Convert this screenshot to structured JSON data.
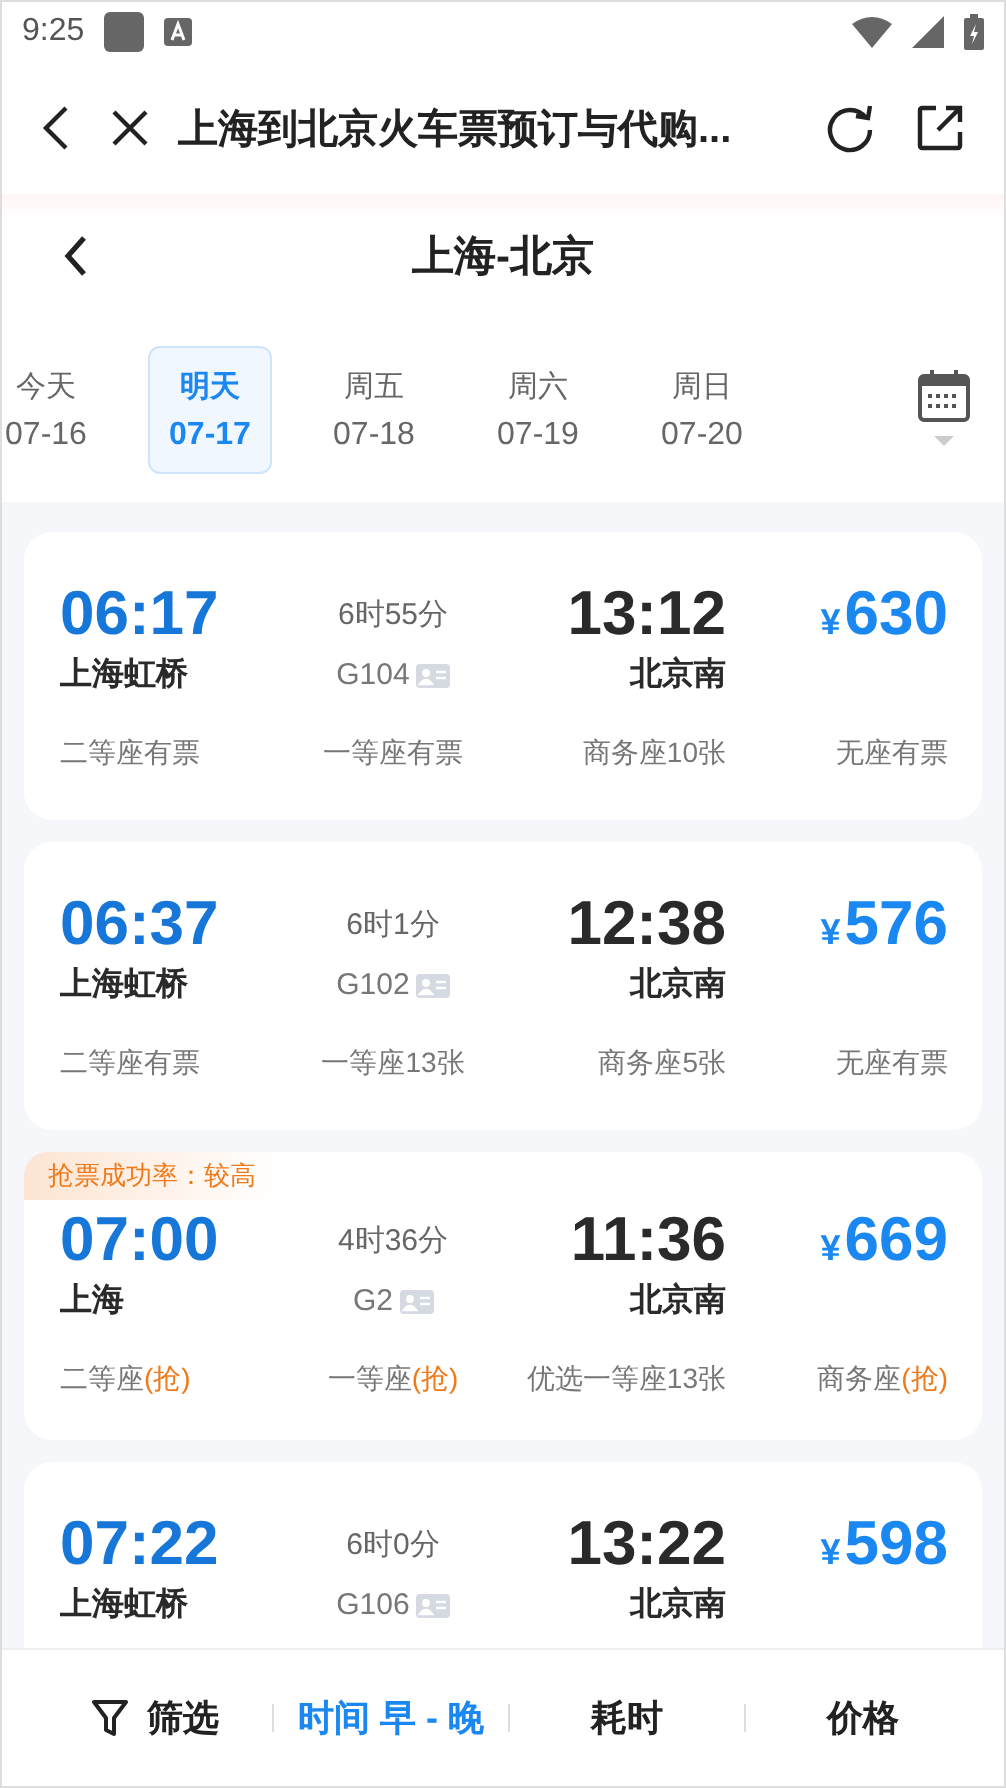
{
  "status_bar": {
    "time": "9:25"
  },
  "title_bar": {
    "title": "上海到北京火车票预订与代购..."
  },
  "route_header": {
    "title": "上海-北京"
  },
  "dates": [
    {
      "weekday": "今天",
      "date": "07-16",
      "selected": false
    },
    {
      "weekday": "明天",
      "date": "07-17",
      "selected": true
    },
    {
      "weekday": "周五",
      "date": "07-18",
      "selected": false
    },
    {
      "weekday": "周六",
      "date": "07-19",
      "selected": false
    },
    {
      "weekday": "周日",
      "date": "07-20",
      "selected": false
    }
  ],
  "trains": [
    {
      "depart": "06:17",
      "from": "上海虹桥",
      "duration": "6时55分",
      "number": "G104",
      "arrive": "13:12",
      "to": "北京南",
      "currency": "¥",
      "price": "630",
      "seats": [
        {
          "text": "二等座有票"
        },
        {
          "text": "一等座有票"
        },
        {
          "text": "商务座10张"
        },
        {
          "text": "无座有票"
        }
      ]
    },
    {
      "depart": "06:37",
      "from": "上海虹桥",
      "duration": "6时1分",
      "number": "G102",
      "arrive": "12:38",
      "to": "北京南",
      "currency": "¥",
      "price": "576",
      "seats": [
        {
          "text": "二等座有票"
        },
        {
          "text": "一等座13张"
        },
        {
          "text": "商务座5张"
        },
        {
          "text": "无座有票"
        }
      ]
    },
    {
      "badge": "抢票成功率：较高",
      "depart": "07:00",
      "from": "上海",
      "duration": "4时36分",
      "number": "G2",
      "arrive": "11:36",
      "to": "北京南",
      "currency": "¥",
      "price": "669",
      "seats": [
        {
          "text": "二等座",
          "extra": "(抢)"
        },
        {
          "text": "一等座",
          "extra": "(抢)"
        },
        {
          "text": "优选一等座13张"
        },
        {
          "text": "商务座",
          "extra": "(抢)"
        }
      ]
    },
    {
      "depart": "07:22",
      "from": "上海虹桥",
      "duration": "6时0分",
      "number": "G106",
      "arrive": "13:22",
      "to": "北京南",
      "currency": "¥",
      "price": "598"
    }
  ],
  "sort_bar": [
    {
      "kind": "filter",
      "label": "筛选",
      "selected": false
    },
    {
      "kind": "sort",
      "label": "时间 早 - 晚",
      "selected": true
    },
    {
      "kind": "sort",
      "label": "耗时",
      "selected": false
    },
    {
      "kind": "sort",
      "label": "价格",
      "selected": false
    }
  ]
}
